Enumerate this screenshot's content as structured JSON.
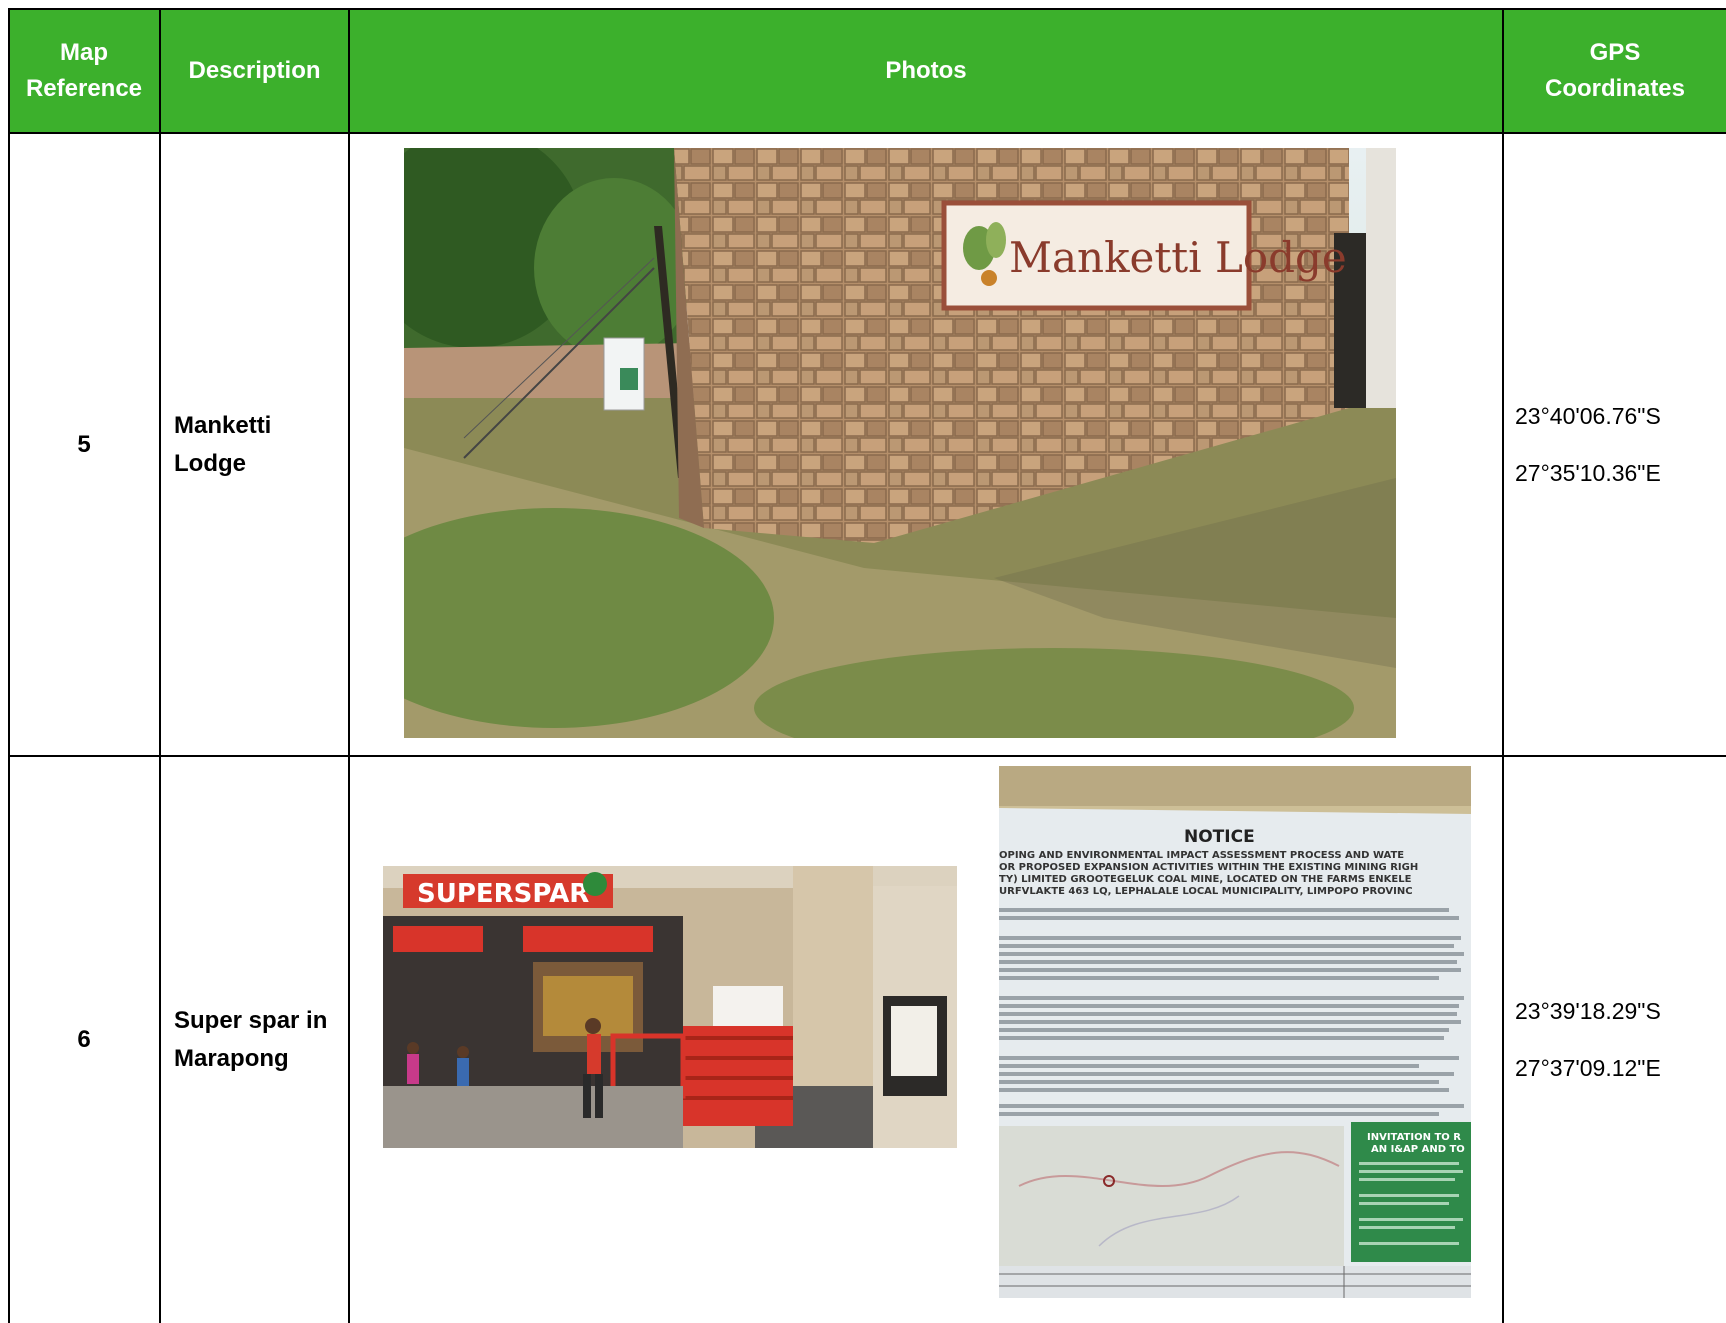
{
  "table": {
    "headers": {
      "map_reference": [
        "Map",
        "Reference"
      ],
      "description": "Description",
      "photos": "Photos",
      "gps": [
        "GPS",
        "Coordinates"
      ]
    },
    "rows": [
      {
        "map_ref": "5",
        "description": [
          "Manketti",
          "Lodge"
        ],
        "gps_lat": "23°40'06.76\"S",
        "gps_lon": "27°35'10.36\"E",
        "photo_sign_text": "Manketti Lodge"
      },
      {
        "map_ref": "6",
        "description": [
          "Super spar in",
          "Marapong"
        ],
        "gps_lat": "23°39'18.29\"S",
        "gps_lon": "27°37'09.12\"E",
        "photo_store_sign": "SUPERSPAR",
        "photo_notice_title": "NOTICE",
        "photo_notice_lines": [
          "OPING AND ENVIRONMENTAL IMPACT ASSESSMENT PROCESS AND WATE",
          "OR PROPOSED EXPANSION ACTIVITIES WITHIN THE EXISTING MINING RIGH",
          "TY) LIMITED GROOTEGELUK COAL MINE, LOCATED ON THE FARMS ENKELE",
          "URFVLAKTE 463 LQ, LEPHALALE LOCAL MUNICIPALITY, LIMPOPO PROVINC"
        ],
        "photo_notice_box_title": [
          "INVITATION TO R",
          "AN I&AP AND TO"
        ]
      }
    ]
  },
  "colors": {
    "header_green": "#3cb02c",
    "header_text": "#ffffff",
    "grid": "#000000"
  }
}
